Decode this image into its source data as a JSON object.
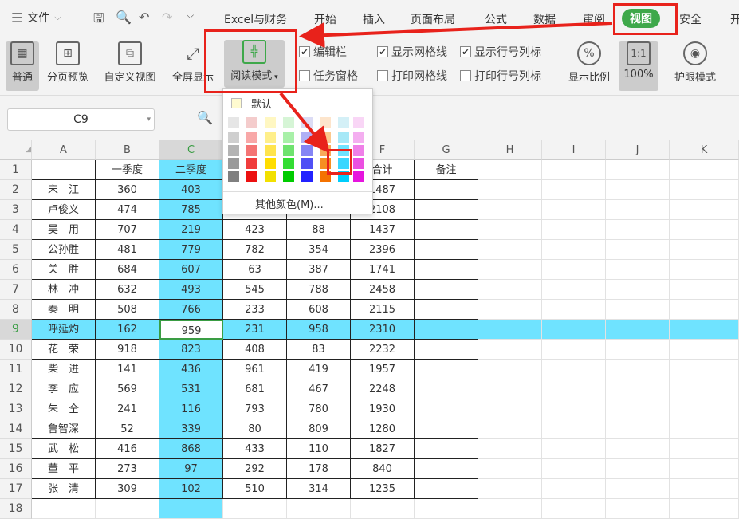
{
  "topbar": {
    "menu_icon": "hamburger-icon",
    "file_label": "文件",
    "tabs": [
      "Excel与财务",
      "开始",
      "插入",
      "页面布局",
      "公式",
      "数据",
      "审阅",
      "视图",
      "安全",
      "开"
    ]
  },
  "ribbon": {
    "buttons": [
      "普通",
      "分页预览",
      "自定义视图",
      "全屏显示",
      "阅读模式",
      "显示比例",
      "100%",
      "护眼模式"
    ],
    "zoom_icon_text": "1:1",
    "checks": [
      {
        "label": "编辑栏",
        "checked": true
      },
      {
        "label": "显示网格线",
        "checked": true
      },
      {
        "label": "显示行号列标",
        "checked": true
      },
      {
        "label": "任务窗格",
        "checked": false
      },
      {
        "label": "打印网格线",
        "checked": false
      },
      {
        "label": "打印行号列标",
        "checked": false
      }
    ]
  },
  "namebox": "C9",
  "dropdown": {
    "default_label": "默认",
    "more_label": "其他颜色(M)..."
  },
  "columns": [
    "A",
    "B",
    "C",
    "D",
    "E",
    "F",
    "G",
    "H",
    "I",
    "J",
    "K"
  ],
  "headers": [
    "",
    "一季度",
    "二季度",
    "",
    "",
    "合计",
    "备注"
  ],
  "rows": [
    [
      "宋　江",
      "360",
      "403",
      "",
      "",
      "1487"
    ],
    [
      "卢俊义",
      "474",
      "785",
      "",
      "",
      "2108"
    ],
    [
      "吴　用",
      "707",
      "219",
      "423",
      "88",
      "1437"
    ],
    [
      "公孙胜",
      "481",
      "779",
      "782",
      "354",
      "2396"
    ],
    [
      "关　胜",
      "684",
      "607",
      "63",
      "387",
      "1741"
    ],
    [
      "林　冲",
      "632",
      "493",
      "545",
      "788",
      "2458"
    ],
    [
      "秦　明",
      "508",
      "766",
      "233",
      "608",
      "2115"
    ],
    [
      "呼延灼",
      "162",
      "959",
      "231",
      "958",
      "2310"
    ],
    [
      "花　荣",
      "918",
      "823",
      "408",
      "83",
      "2232"
    ],
    [
      "柴　进",
      "141",
      "436",
      "961",
      "419",
      "1957"
    ],
    [
      "李　应",
      "569",
      "531",
      "681",
      "467",
      "2248"
    ],
    [
      "朱　仝",
      "241",
      "116",
      "793",
      "780",
      "1930"
    ],
    [
      "鲁智深",
      "52",
      "339",
      "80",
      "809",
      "1280"
    ],
    [
      "武　松",
      "416",
      "868",
      "433",
      "110",
      "1827"
    ],
    [
      "董　平",
      "273",
      "97",
      "292",
      "178",
      "840"
    ],
    [
      "张　清",
      "309",
      "102",
      "510",
      "314",
      "1235"
    ]
  ],
  "highlight_color": "#6fe3ff"
}
